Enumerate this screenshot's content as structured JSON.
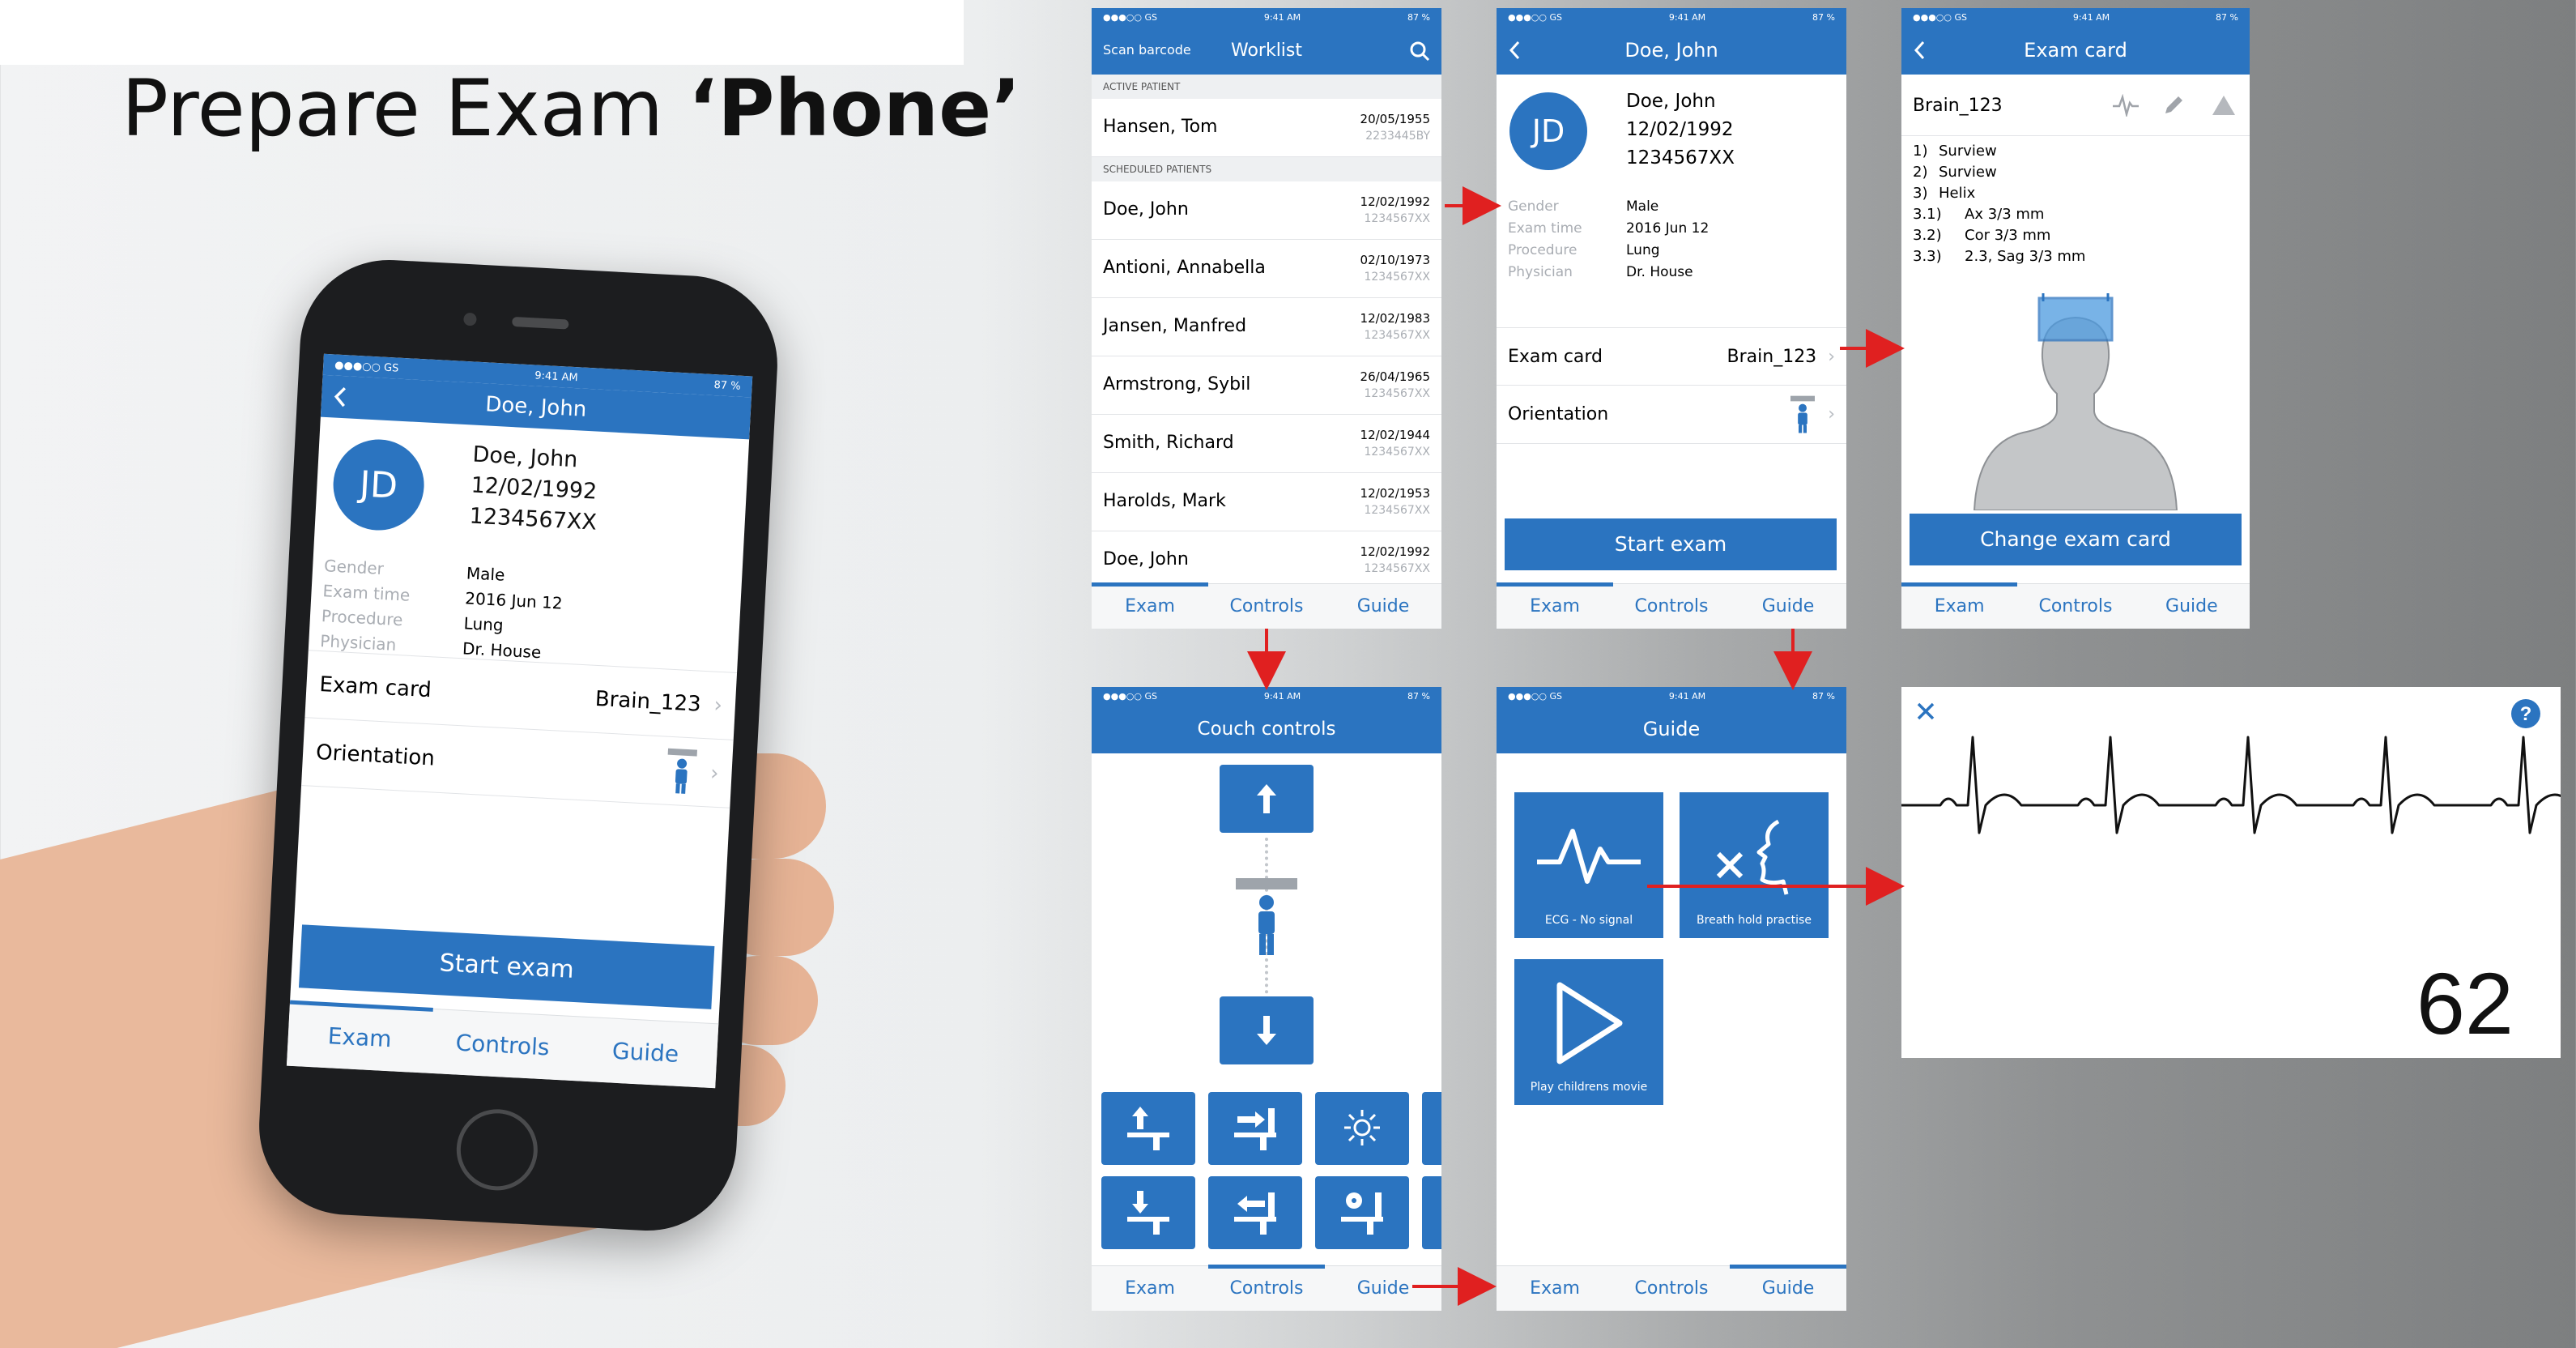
{
  "title": {
    "prefix": "Prepare Exam ",
    "emphasis": "‘Phone’"
  },
  "status_bar": {
    "carrier": "●●●○○ GS",
    "time": "9:41 AM",
    "battery": "87 %"
  },
  "phone": {
    "nav_title": "Doe, John",
    "patient": {
      "initials": "JD",
      "name": "Doe, John",
      "dob": "12/02/1992",
      "id": "1234567XX"
    },
    "details": [
      {
        "label": "Gender",
        "value": "Male"
      },
      {
        "label": "Exam time",
        "value": "2016 Jun 12"
      },
      {
        "label": "Procedure",
        "value": "Lung"
      },
      {
        "label": "Physician",
        "value": "Dr. House"
      }
    ],
    "exam_card_label": "Exam card",
    "exam_card_value": "Brain_123",
    "orientation_label": "Orientation",
    "start_button": "Start exam"
  },
  "tabs": [
    "Exam",
    "Controls",
    "Guide"
  ],
  "worklist": {
    "scan_barcode": "Scan barcode",
    "title": "Worklist",
    "active_header": "ACTIVE PATIENT",
    "active": {
      "name": "Hansen, Tom",
      "date": "20/05/1955",
      "id": "2233445BY"
    },
    "scheduled_header": "SCHEDULED PATIENTS",
    "scheduled": [
      {
        "name": "Doe, John",
        "date": "12/02/1992",
        "id": "1234567XX"
      },
      {
        "name": "Antioni, Annabella",
        "date": "02/10/1973",
        "id": "1234567XX"
      },
      {
        "name": "Jansen, Manfred",
        "date": "12/02/1983",
        "id": "1234567XX"
      },
      {
        "name": "Armstrong, Sybil",
        "date": "26/04/1965",
        "id": "1234567XX"
      },
      {
        "name": "Smith, Richard",
        "date": "12/02/1944",
        "id": "1234567XX"
      },
      {
        "name": "Harolds, Mark",
        "date": "12/02/1953",
        "id": "1234567XX"
      },
      {
        "name": "Doe, John",
        "date": "12/02/1992",
        "id": "1234567XX"
      }
    ]
  },
  "exam_card": {
    "title": "Exam card",
    "name": "Brain_123",
    "steps": [
      {
        "num": "1)",
        "text": "Surview"
      },
      {
        "num": "2)",
        "text": "Surview"
      },
      {
        "num": "3)",
        "text": "Helix"
      },
      {
        "num": "3.1)",
        "text": "Ax 3/3 mm"
      },
      {
        "num": "3.2)",
        "text": "Cor 3/3 mm"
      },
      {
        "num": "3.3)",
        "text": "2.3, Sag 3/3 mm"
      }
    ],
    "change_button": "Change exam card"
  },
  "couch": {
    "title": "Couch controls"
  },
  "guide": {
    "title": "Guide",
    "tiles": [
      "ECG - No signal",
      "Breath hold practise",
      "Play childrens movie"
    ]
  },
  "ecg": {
    "heart_rate": "62"
  },
  "colors": {
    "accent": "#2b74c0",
    "arrow": "#e02020"
  }
}
